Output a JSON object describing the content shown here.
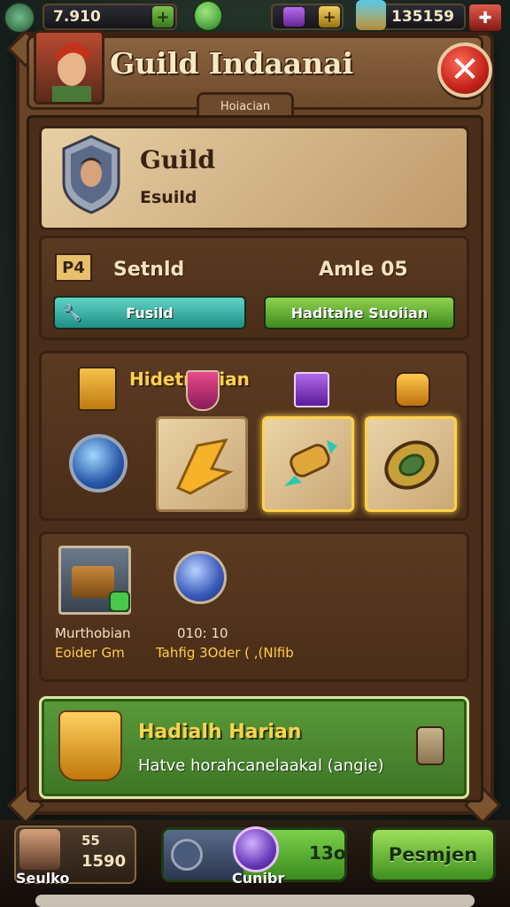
{
  "topbar": {
    "left_value": "7.910",
    "right_value": "135159"
  },
  "header": {
    "title": "Guild Indaanai",
    "tab_label": "Hoiacian",
    "close_symbol": "✕"
  },
  "guild": {
    "name": "Guild",
    "subtitle": "Esuild"
  },
  "stats": {
    "icon_text": "P4",
    "left_label": "Setnld",
    "right_label": "Amle 05",
    "button_left": "Fusild",
    "button_right": "Haditahe Suoiian"
  },
  "rewards": {
    "title": "Hidetr arian"
  },
  "materials": {
    "item1_name": "Murthobian",
    "item1_sub": "Eoider Gm",
    "item2_value": "010: 10",
    "item2_sub": "Tahfig  3Oder ( ,(Nlfib"
  },
  "daily": {
    "title": "Hadialh Harian",
    "description": "Hatve horahcanelaakal (angie)"
  },
  "bottom": {
    "profile_level": "55",
    "profile_score": "1590",
    "profile_name": "Seulko",
    "craft_value": "13o",
    "craft_label": "Cunibr",
    "primary_label": "Pesmjen"
  },
  "colors": {
    "wood": "#6b4528",
    "parchment": "#e7cfa3",
    "gold_text": "#ffd24a",
    "green_button": "#3d8a1f",
    "teal_button": "#1f8f85",
    "close_red": "#c4231b"
  },
  "icons": [
    "guild-crest-icon",
    "avatar-icon",
    "close-icon",
    "wrench-icon",
    "chest-icon",
    "shield-icon",
    "gem-icon",
    "gold-shard-icon",
    "scroll-icon",
    "ring-icon",
    "bomb-icon",
    "lock-icon",
    "orb-icon"
  ]
}
